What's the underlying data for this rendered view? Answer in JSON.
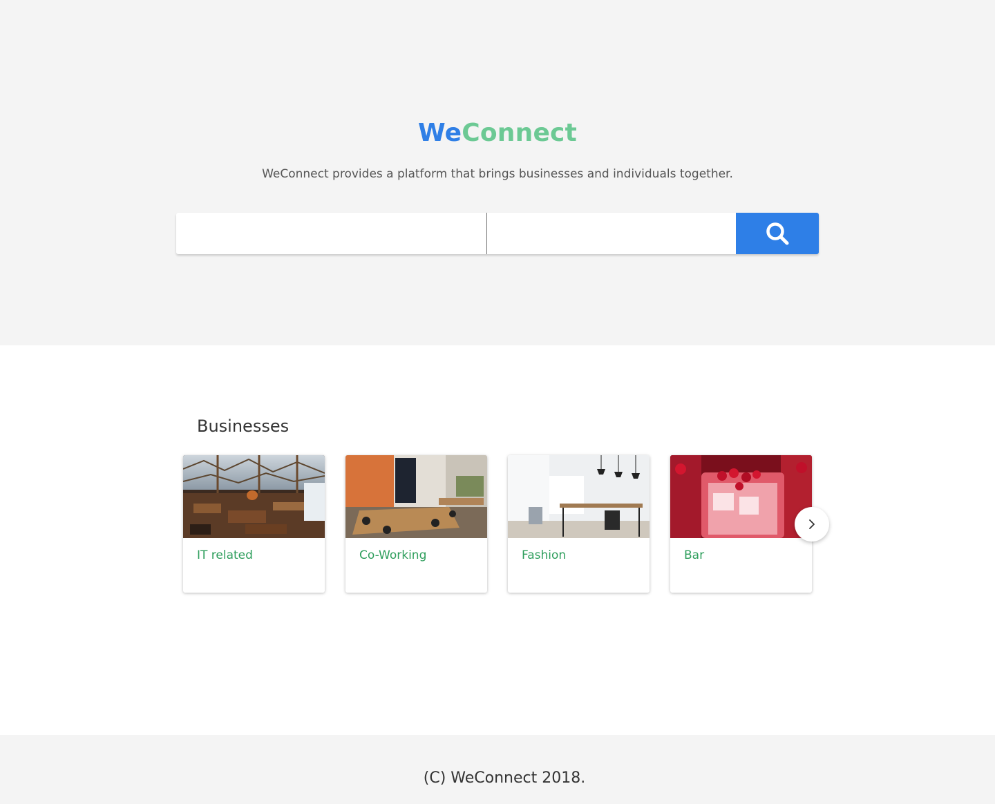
{
  "brand": {
    "part1": "We",
    "part2": "Connect"
  },
  "hero": {
    "tagline": "WeConnect provides a platform that brings businesses and individuals together."
  },
  "search": {
    "field1_value": "",
    "field2_value": "",
    "button_icon": "search-icon"
  },
  "businesses": {
    "title": "Businesses",
    "cards": [
      {
        "label": "IT related",
        "image": "cafe-interior-photo"
      },
      {
        "label": "Co-Working",
        "image": "meeting-room-photo"
      },
      {
        "label": "Fashion",
        "image": "white-office-photo"
      },
      {
        "label": "Bar",
        "image": "red-drink-photo"
      }
    ],
    "next_icon": "chevron-right-icon"
  },
  "footer": {
    "text": "(C) WeConnect 2018."
  },
  "colors": {
    "brand_blue": "#2f7fe6",
    "brand_green": "#6cc994",
    "label_green": "#2e9e5c",
    "search_button": "#2e7fe7",
    "hero_background": "#f4f4f4"
  }
}
